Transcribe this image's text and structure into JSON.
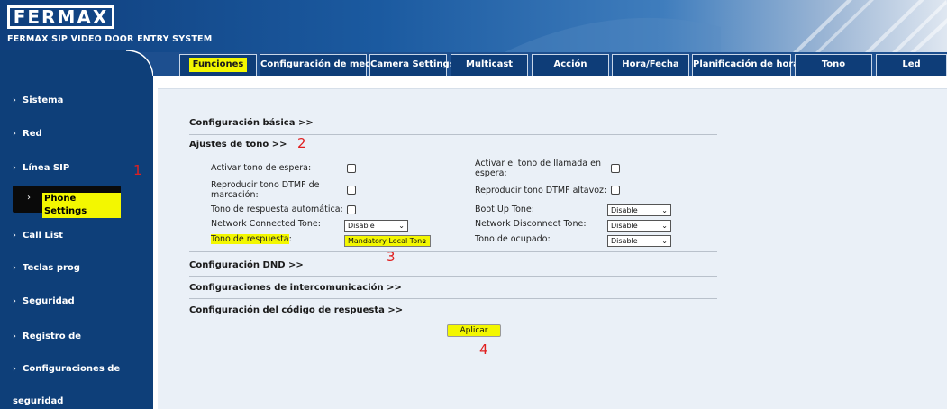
{
  "header": {
    "logo_text": "FERMAX",
    "subtitle": "FERMAX SIP VIDEO DOOR ENTRY SYSTEM"
  },
  "tabs": [
    {
      "label": "Funciones",
      "active": true
    },
    {
      "label": "Configuración de medios",
      "active": false
    },
    {
      "label": "Camera Settings",
      "active": false
    },
    {
      "label": "Multicast",
      "active": false
    },
    {
      "label": "Acción",
      "active": false
    },
    {
      "label": "Hora/Fecha",
      "active": false
    },
    {
      "label": "Planificación de horario",
      "active": false
    },
    {
      "label": "Tono",
      "active": false
    },
    {
      "label": "Led",
      "active": false
    }
  ],
  "sidebar": {
    "chevron": "›",
    "items": [
      {
        "label": "Sistema"
      },
      {
        "label": "Red"
      },
      {
        "label": "Línea SIP"
      },
      {
        "label": "Phone Settings",
        "active": true
      },
      {
        "label": "Call List"
      },
      {
        "label": "Teclas prog"
      },
      {
        "label": "Seguridad"
      },
      {
        "label": "Registro de"
      },
      {
        "label": "Configuraciones de"
      },
      {
        "label": "seguridad"
      }
    ]
  },
  "annotations": {
    "n1": "1",
    "n2": "2",
    "n3": "3",
    "n4": "4"
  },
  "sections": {
    "basic": "Configuración básica >>",
    "tone": "Ajustes de tono >>",
    "dnd": "Configuración DND >>",
    "intercom": "Configuraciones de intercomunicación >>",
    "answer_code": "Configuración del código de respuesta >>"
  },
  "tone_settings": {
    "hold_tone": {
      "label": "Activar tono de espera:",
      "checked": false
    },
    "call_waiting_tone": {
      "label": "Activar el tono de llamada en espera:",
      "checked": false
    },
    "dtmf_dial": {
      "label": "Reproducir tono DTMF de marcación:",
      "checked": false
    },
    "dtmf_speaker": {
      "label": "Reproducir tono DTMF altavoz:",
      "checked": false
    },
    "auto_answer_tone": {
      "label": "Tono de respuesta automática:",
      "checked": false
    },
    "boot_up_tone": {
      "label": "Boot Up Tone:",
      "value": "Disable"
    },
    "network_connected": {
      "label": "Network Connected Tone:",
      "value": "Disable"
    },
    "network_disconnect": {
      "label": "Network Disconnect Tone:",
      "value": "Disable"
    },
    "answer_tone": {
      "label": "Tono de respuesta",
      "colon": ":",
      "value": "Mandatory Local Tone"
    },
    "busy_tone": {
      "label": "Tono de ocupado:",
      "value": "Disable"
    }
  },
  "apply_button": {
    "label": "Aplicar"
  },
  "icons": {
    "dropdown": "chevron-down-icon",
    "sidebar_bullet": "chevron-right-icon"
  },
  "colors": {
    "highlight": "#f3f700",
    "sidebar": "#0e3f79",
    "tab": "#0e3d78",
    "annotation": "#e02020"
  }
}
